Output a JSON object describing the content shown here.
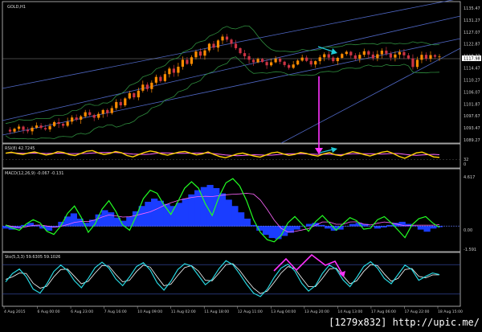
{
  "watermark": "[1279x832] http://upic.me/",
  "colors": {
    "background": "#000000",
    "frame": "#c8c8c8",
    "bull_candle": "#ff8c00",
    "bear_candle": "#cc3344",
    "channel": "#4f67c4",
    "bands": "#2e8b3d",
    "rsi_line": "#ffd200",
    "rsi_signal": "#ff66ff",
    "macd_hist": "#1a3dff",
    "macd_line": "#22ff22",
    "macd_signal": "#ff66ff",
    "stoch_main": "#27d6e0",
    "stoch_signal": "#ffffff",
    "annotation_arrow": "#ff33ff",
    "trend_arrow": "#1fc9d6",
    "current_price_label": "#ffffff"
  },
  "chart_data": [
    {
      "type": "candlestick",
      "title": "GOLD,H1",
      "y_ticks": [
        "1135.47",
        "1131.27",
        "1127.07",
        "1122.87",
        "1118.77",
        "1114.47",
        "1110.27",
        "1106.07",
        "1101.87",
        "1097.67",
        "1093.47",
        "1089.27"
      ],
      "current_price": "1117.98",
      "ylim": [
        1087.5,
        1137.0
      ],
      "x_ticks": [
        "4 Aug 2015",
        "6 Aug 00:00",
        "6 Aug 23:00",
        "7 Aug 16:00",
        "10 Aug 09:00",
        "11 Aug 02:00",
        "11 Aug 18:00",
        "12 Aug 11:00",
        "13 Aug 04:00",
        "13 Aug 20:00",
        "14 Aug 13:00",
        "17 Aug 06:00",
        "17 Aug 22:00",
        "18 Aug 15:00"
      ],
      "close_path": [
        1091.5,
        1090.8,
        1091.8,
        1092.6,
        1091.4,
        1090.9,
        1092.2,
        1093.0,
        1092.1,
        1091.6,
        1092.8,
        1094.2,
        1093.6,
        1092.9,
        1094.4,
        1095.9,
        1095.1,
        1096.3,
        1097.8,
        1096.8,
        1095.8,
        1097.2,
        1098.6,
        1097.5,
        1099.3,
        1101.5,
        1100.3,
        1102.8,
        1104.7,
        1103.2,
        1105.6,
        1107.8,
        1106.2,
        1108.5,
        1110.6,
        1109.1,
        1111.6,
        1113.6,
        1112.1,
        1114.3,
        1116.8,
        1115.3,
        1117.7,
        1119.8,
        1118.3,
        1120.2,
        1122.6,
        1121.2,
        1123.8,
        1125.2,
        1124.1,
        1122.6,
        1121.0,
        1119.2,
        1118.1,
        1116.8,
        1115.9,
        1117.1,
        1116.0,
        1114.8,
        1115.9,
        1117.2,
        1116.1,
        1114.9,
        1113.9,
        1115.1,
        1116.5,
        1117.6,
        1116.4,
        1115.1,
        1116.3,
        1117.7,
        1118.8,
        1117.6,
        1116.3,
        1117.5,
        1118.9,
        1119.7,
        1118.4,
        1117.2,
        1118.6,
        1119.9,
        1118.7,
        1117.4,
        1118.8,
        1120.1,
        1119.0,
        1117.6,
        1118.7,
        1119.6,
        1118.4,
        1117.3,
        1114.2,
        1116.8,
        1118.6,
        1117.2,
        1118.5,
        1117.9,
        1117.98
      ],
      "overlays": [
        "Bollinger Bands",
        "trend channel lines"
      ],
      "annotation": "vertical arrow at 18 Aug 02:00 pointing down toward the oscillator panels"
    },
    {
      "type": "line",
      "title": "RSI(8) 42.7245",
      "y_ticks": [
        "",
        "32",
        "0"
      ],
      "ylim": [
        0,
        100
      ],
      "series": [
        {
          "values": [
            64,
            69,
            62,
            58,
            66,
            71,
            63,
            55,
            61,
            72,
            68,
            57,
            52,
            63,
            74,
            78,
            66,
            58,
            63,
            73,
            67,
            52,
            45,
            57,
            68,
            76,
            71,
            60,
            54,
            62,
            70,
            73,
            64,
            56,
            61,
            71,
            58,
            47,
            41,
            50,
            60,
            65,
            57,
            49,
            44,
            55,
            66,
            70,
            61,
            53,
            58,
            68,
            63,
            54,
            49,
            61,
            67,
            56,
            51,
            63,
            72,
            66,
            57,
            50,
            59,
            69,
            74,
            63,
            48,
            38,
            52,
            66,
            70,
            58,
            45,
            42.7
          ]
        }
      ]
    },
    {
      "type": "bar",
      "title": "MACD(12,26,9) -0.067 -0.131",
      "y_ticks": [
        "4.617",
        "0.00",
        "-1.591"
      ],
      "ylim": [
        -2.2,
        5.2
      ],
      "series": [
        {
          "values": [
            -0.2,
            -0.3,
            -0.2,
            0.1,
            0.3,
            0.1,
            -0.2,
            -0.4,
            -0.1,
            0.4,
            0.9,
            1.2,
            0.7,
            0.3,
            0.6,
            1.1,
            1.5,
            1.3,
            0.8,
            0.5,
            0.9,
            1.4,
            1.9,
            2.3,
            2.6,
            2.4,
            2.1,
            1.9,
            2.2,
            2.6,
            3.0,
            3.4,
            3.7,
            3.9,
            3.6,
            3.1,
            2.5,
            1.9,
            1.3,
            0.7,
            0.1,
            -0.4,
            -0.8,
            -1.1,
            -1.2,
            -0.9,
            -0.6,
            -0.3,
            0.0,
            0.2,
            0.3,
            0.1,
            -0.2,
            -0.4,
            -0.3,
            0.0,
            0.2,
            0.3,
            0.2,
            0.0,
            -0.2,
            -0.1,
            0.1,
            0.3,
            0.4,
            0.2,
            0.0,
            -0.3,
            -0.5,
            -0.2,
            -0.067
          ]
        },
        {
          "values": [
            0.1,
            -0.2,
            -0.4,
            0.2,
            0.6,
            0.3,
            -0.5,
            -0.8,
            0.0,
            1.2,
            1.9,
            0.8,
            -0.6,
            0.2,
            1.6,
            2.4,
            1.4,
            0.1,
            -0.4,
            1.0,
            2.6,
            3.4,
            3.1,
            2.0,
            1.1,
            2.3,
            3.6,
            4.2,
            3.6,
            2.1,
            1.0,
            2.8,
            4.1,
            4.5,
            3.8,
            2.4,
            0.6,
            -0.6,
            -1.3,
            -1.5,
            -0.9,
            0.3,
            0.9,
            0.2,
            -0.5,
            0.4,
            1.0,
            0.3,
            -0.4,
            0.2,
            0.8,
            0.5,
            -0.3,
            -0.2,
            0.6,
            0.9,
            0.3,
            -0.4,
            -1.1,
            0.1,
            0.7,
            0.9,
            0.3,
            -0.131
          ]
        }
      ]
    },
    {
      "type": "line",
      "title": "Sto(5,3,3) 59.6305 59.1026",
      "y_ticks": [
        "",
        ""
      ],
      "ylim": [
        0,
        100
      ],
      "series": [
        {
          "values": [
            45,
            62,
            71,
            55,
            30,
            22,
            41,
            66,
            79,
            68,
            47,
            33,
            52,
            74,
            85,
            73,
            51,
            37,
            55,
            76,
            84,
            69,
            43,
            28,
            46,
            70,
            82,
            77,
            58,
            39,
            50,
            72,
            88,
            80,
            61,
            40,
            22,
            15,
            30,
            54,
            73,
            81,
            67,
            42,
            26,
            37,
            62,
            79,
            71,
            49,
            35,
            54,
            76,
            86,
            73,
            52,
            41,
            60,
            79,
            70,
            48,
            56,
            63,
            59.6
          ]
        },
        {
          "values": [
            50,
            55,
            63,
            62,
            42,
            32,
            36,
            55,
            70,
            71,
            56,
            41,
            46,
            63,
            78,
            77,
            60,
            45,
            48,
            66,
            79,
            75,
            55,
            37,
            40,
            58,
            74,
            78,
            67,
            48,
            47,
            63,
            80,
            82,
            68,
            49,
            32,
            21,
            26,
            44,
            63,
            76,
            72,
            53,
            35,
            35,
            52,
            71,
            73,
            57,
            41,
            47,
            66,
            80,
            78,
            61,
            46,
            52,
            70,
            72,
            56,
            53,
            59,
            59.1
          ]
        }
      ]
    }
  ]
}
